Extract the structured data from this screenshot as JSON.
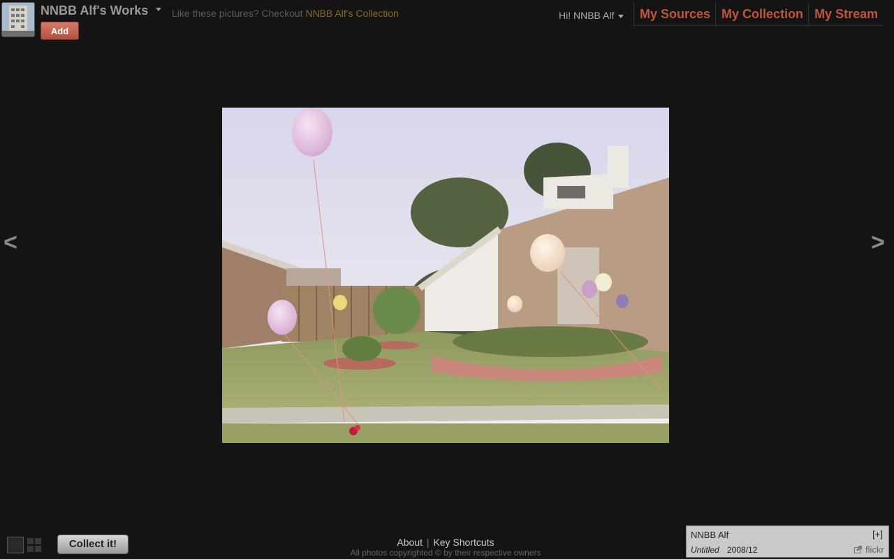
{
  "header": {
    "site_title": "NNBB Alf's Works",
    "promo_text": "Like these pictures? Checkout ",
    "promo_link": "NNBB Alf's Collection",
    "add_label": "Add",
    "greeting": "Hi! NNBB Alf"
  },
  "nav": {
    "items": [
      {
        "label": "My Sources"
      },
      {
        "label": "My Collection"
      },
      {
        "label": "My Stream"
      }
    ]
  },
  "viewer": {
    "prev_label": "<",
    "next_label": ">"
  },
  "footer": {
    "about": "About",
    "separator": "|",
    "shortcuts": "Key Shortcuts",
    "copyright": "All photos copyrighted © by their respective owners",
    "collect_label": "Collect it!"
  },
  "photo_info": {
    "author": "NNBB Alf",
    "expand": "[+]",
    "title": "Untitled",
    "date": "2008/12",
    "source": "flickr"
  },
  "colors": {
    "accent": "#c0553f",
    "background": "#141414",
    "add_button": "#c8604c"
  },
  "icons": {
    "title_menu": "chevron-down-icon",
    "user_menu": "chevron-down-icon",
    "view_single": "single-view-icon",
    "view_grid": "grid-view-icon",
    "external_link": "external-link-icon"
  }
}
